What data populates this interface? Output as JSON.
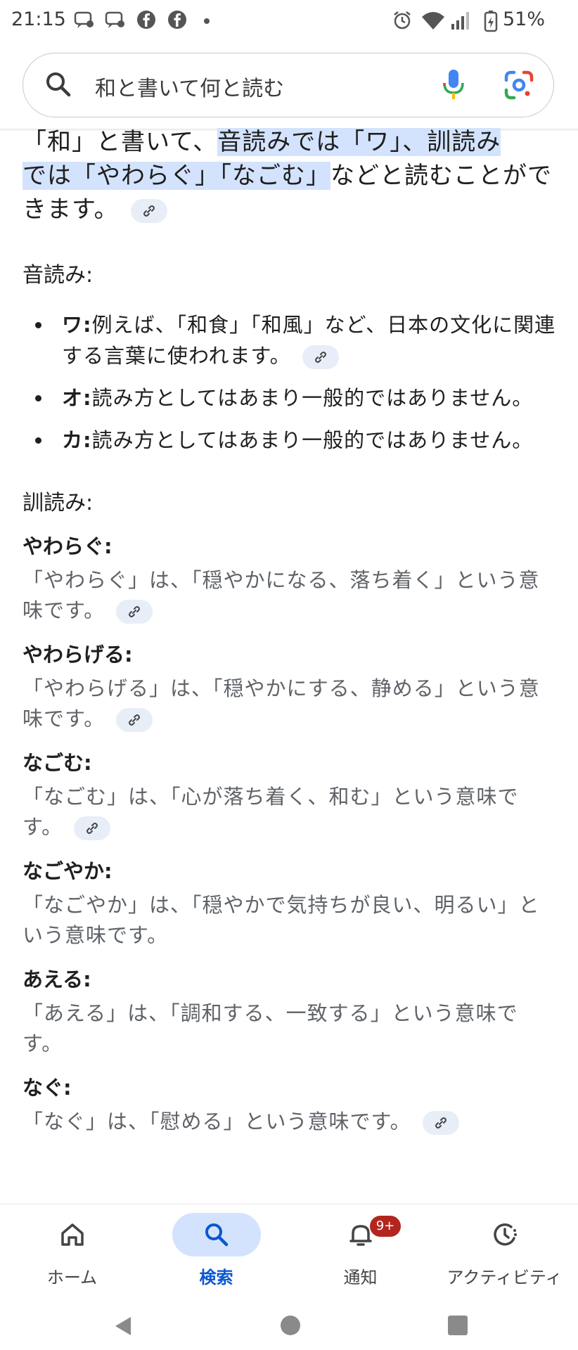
{
  "status_bar": {
    "time": "21:15",
    "battery": "51%",
    "icons": [
      "chat-bubble-icon",
      "chat-bubble-icon",
      "facebook-icon",
      "facebook-icon",
      "dot-icon",
      "alarm-icon",
      "wifi-icon",
      "signal-icon",
      "battery-icon"
    ]
  },
  "search": {
    "query": "和と書いて何と読む"
  },
  "content": {
    "lead_part1": "「和」と書いて、",
    "lead_highlight1": "音読みでは「ワ」、訓読み",
    "lead_highlight2": "では「やわらぐ」「なごむ」",
    "lead_part2": "などと読むことができます。",
    "onyomi_heading": "音読み:",
    "onyomi": [
      {
        "term": "ワ:",
        "text": "例えば、「和食」「和風」など、日本の文化に関連する言葉に使われます。"
      },
      {
        "term": "オ:",
        "text": "読み方としてはあまり一般的ではありません。"
      },
      {
        "term": "カ:",
        "text": "読み方としてはあまり一般的ではありません。"
      }
    ],
    "kunyomi_heading": "訓読み:",
    "kunyomi": [
      {
        "term": "やわらぐ:",
        "text": "「やわらぐ」は、「穏やかになる、落ち着く」という意味です。"
      },
      {
        "term": "やわらげる:",
        "text": "「やわらげる」は、「穏やかにする、静める」という意味です。"
      },
      {
        "term": "なごむ:",
        "text": "「なごむ」は、「心が落ち着く、和む」という意味です。"
      },
      {
        "term": "なごやか:",
        "text": "「なごやか」は、「穏やかで気持ちが良い、明るい」という意味です。"
      },
      {
        "term": "あえる:",
        "text": "「あえる」は、「調和する、一致する」という意味です。"
      },
      {
        "term": "なぐ:",
        "text": "「なぐ」は、「慰める」という意味です。"
      }
    ]
  },
  "bottom_nav": {
    "items": [
      {
        "label": "ホーム",
        "icon": "home-icon"
      },
      {
        "label": "検索",
        "icon": "search-icon"
      },
      {
        "label": "通知",
        "icon": "bell-icon",
        "badge": "9+"
      },
      {
        "label": "アクティビティ",
        "icon": "activity-icon"
      }
    ]
  },
  "colors": {
    "accent": "#0b57d0",
    "highlight": "#d3e3fd",
    "badge": "#b3261e"
  }
}
